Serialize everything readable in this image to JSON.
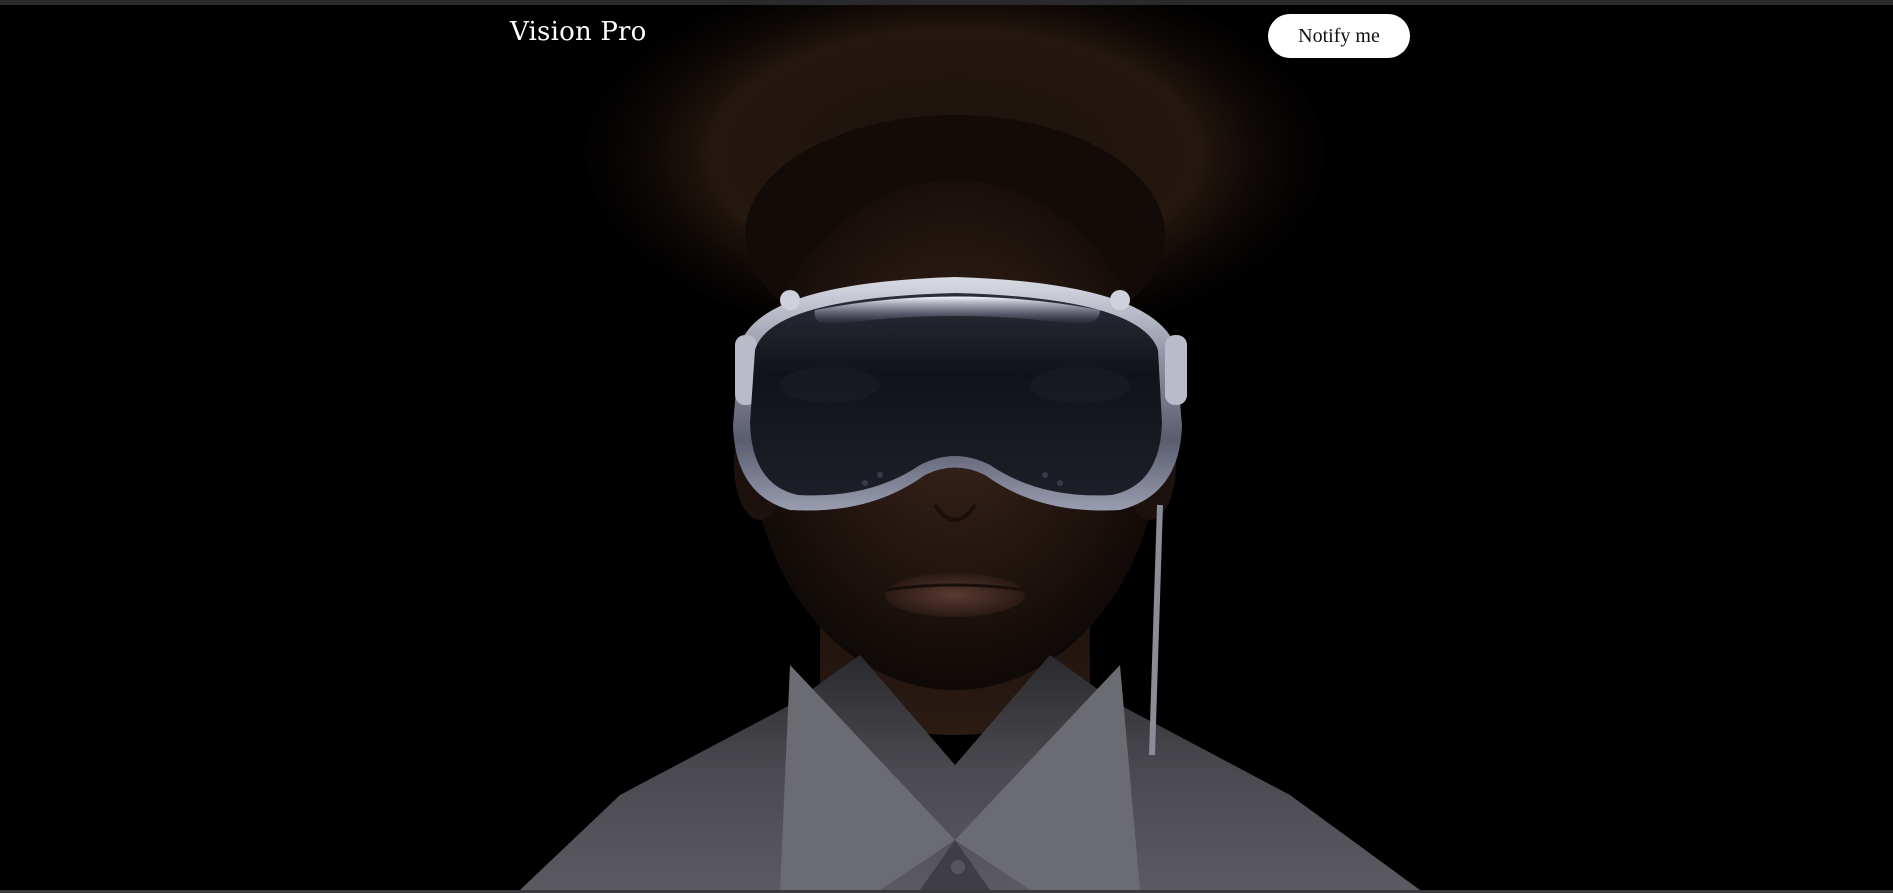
{
  "nav": {
    "brand": "Vision Pro",
    "notify_label": "Notify me"
  },
  "hero": {
    "image": "person-wearing-vision-pro-headset"
  },
  "colors": {
    "background": "#000000",
    "button_bg": "#ffffff",
    "button_text": "#111111",
    "brand_text": "#ffffff"
  }
}
